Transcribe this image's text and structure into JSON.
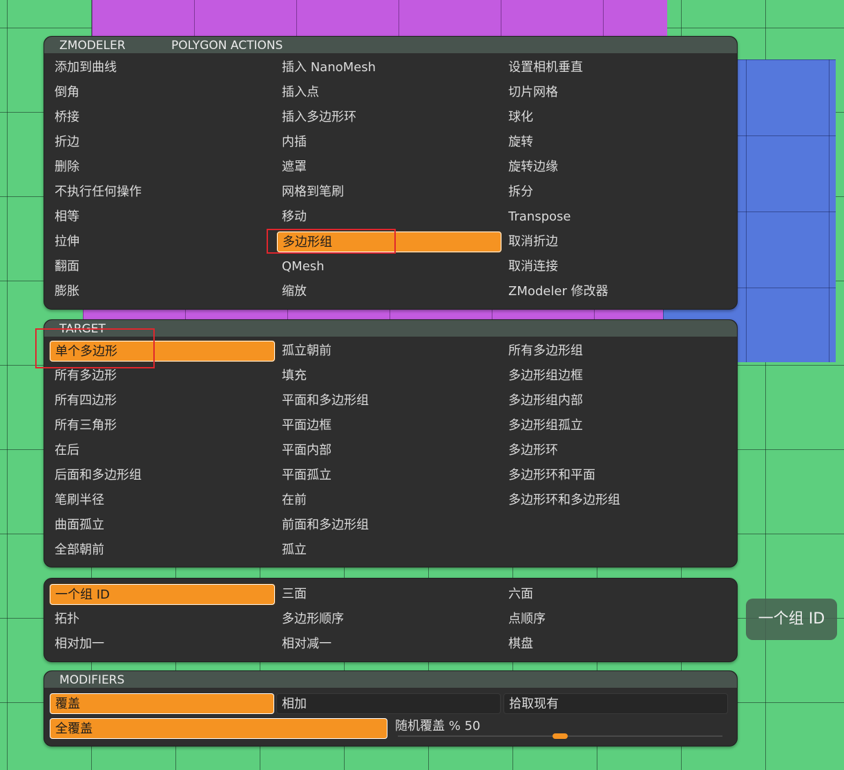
{
  "colors": {
    "accent": "#f59322",
    "panel": "#2e2e2e",
    "highlight": "#e0262d"
  },
  "zmodeler": {
    "tab1": "ZMODELER",
    "tab2": "POLYGON ACTIONS",
    "col1": [
      "添加到曲线",
      "倒角",
      "桥接",
      "折边",
      "删除",
      "不执行任何操作",
      "相等",
      "拉伸",
      "翻面",
      "膨胀"
    ],
    "col2": [
      "插入 NanoMesh",
      "插入点",
      "插入多边形环",
      "内插",
      "遮罩",
      "网格到笔刷",
      "移动",
      "多边形组",
      "QMesh",
      "缩放"
    ],
    "col3": [
      "设置相机垂直",
      "切片网格",
      "球化",
      "旋转",
      "旋转边缘",
      "拆分",
      "Transpose",
      "取消折边",
      "取消连接",
      "ZModeler 修改器"
    ]
  },
  "target": {
    "title": "TARGET",
    "col1": [
      "单个多边形",
      "所有多边形",
      "所有四边形",
      "所有三角形",
      "在后",
      "后面和多边形组",
      "笔刷半径",
      "曲面孤立",
      "全部朝前"
    ],
    "col2": [
      "孤立朝前",
      "填充",
      "平面和多边形组",
      "平面边框",
      "平面内部",
      "平面孤立",
      "在前",
      "前面和多边形组",
      "孤立"
    ],
    "col3": [
      "所有多边形组",
      "多边形组边框",
      "多边形组内部",
      "多边形组孤立",
      "多边形环",
      "多边形环和平面",
      "多边形环和多边形组"
    ]
  },
  "group": {
    "col1": [
      "一个组 ID",
      "拓扑",
      "相对加一"
    ],
    "col2": [
      "三面",
      "多边形顺序",
      "相对减一"
    ],
    "col3": [
      "六面",
      "点顺序",
      "棋盘"
    ]
  },
  "modifiers": {
    "title": "MODIFIERS",
    "row1": [
      "覆盖",
      "相加",
      "拾取现有"
    ],
    "row2_btn": "全覆盖",
    "slider_label": "随机覆盖 %",
    "slider_value": "50",
    "slider_fraction": 0.5
  },
  "float_button": "一个组 ID"
}
